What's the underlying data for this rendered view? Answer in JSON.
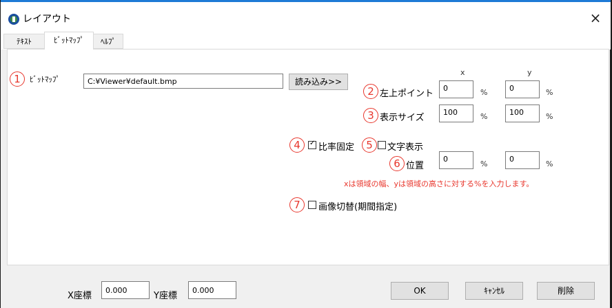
{
  "window": {
    "title": "レイアウト",
    "close_glyph": "×"
  },
  "tabs": [
    {
      "label": "ﾃｷｽﾄ"
    },
    {
      "label": "ﾋﾞｯﾄﾏｯﾌﾟ"
    },
    {
      "label": "ﾍﾙﾌﾟ"
    }
  ],
  "active_tab": "ﾋﾞｯﾄﾏｯﾌﾟ",
  "bitmap": {
    "num": "1",
    "label": "ﾋﾞｯﾄﾏｯﾌﾟ",
    "path_value": "C:¥Viewer¥default.bmp",
    "load_button": "読み込み>>"
  },
  "columns": {
    "x": "x",
    "y": "y"
  },
  "top_left": {
    "num": "2",
    "label": "左上ポイント",
    "x": "0",
    "y": "0",
    "unit": "%"
  },
  "display_size": {
    "num": "3",
    "label": "表示サイズ",
    "x": "100",
    "y": "100",
    "unit": "%"
  },
  "fixed_ratio": {
    "num": "4",
    "label": "比率固定",
    "checked": true,
    "check_glyph": "✓"
  },
  "text_display": {
    "num": "5",
    "label": "文字表示",
    "checked": false
  },
  "position": {
    "num": "6",
    "label": "位置",
    "x": "0",
    "y": "0",
    "unit": "%"
  },
  "note": "xは領域の幅、yは領域の高さに対する%を入力します。",
  "image_switch": {
    "num": "7",
    "label": "画像切替(期間指定)",
    "checked": false
  },
  "footer": {
    "x_label": "X座標",
    "x_value": "0.000",
    "y_label": "Y座標",
    "y_value": "0.000",
    "ok_button": "OK",
    "cancel_button": "ｷｬﾝｾﾙ",
    "delete_button": "削除"
  },
  "colors": {
    "accent": "#1e7ad6",
    "annotation": "#e8362c"
  }
}
